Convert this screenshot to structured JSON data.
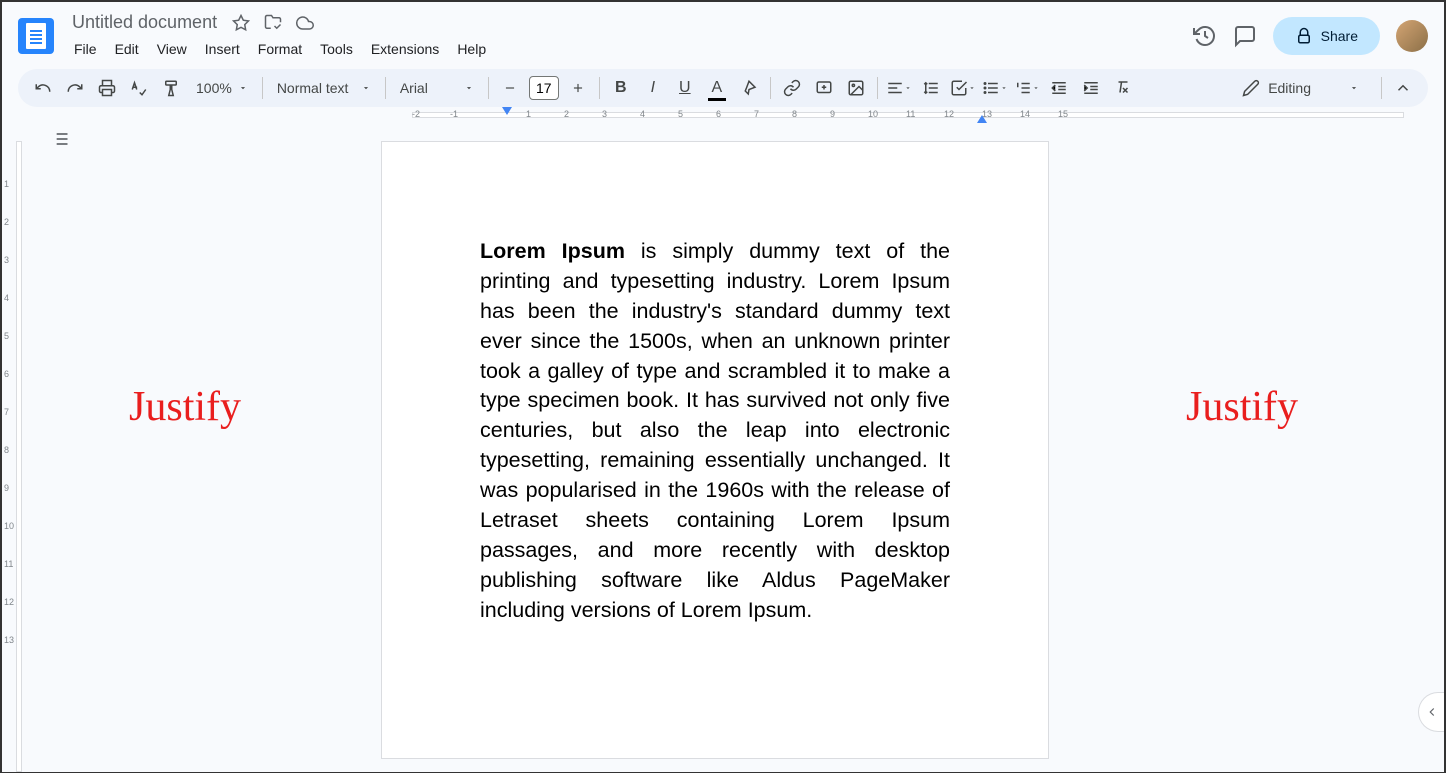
{
  "header": {
    "title": "Untitled document",
    "menu": [
      "File",
      "Edit",
      "View",
      "Insert",
      "Format",
      "Tools",
      "Extensions",
      "Help"
    ],
    "share_label": "Share"
  },
  "toolbar": {
    "zoom": "100%",
    "style": "Normal text",
    "font": "Arial",
    "font_size": "17",
    "editing_label": "Editing"
  },
  "ruler_h": [
    "-2",
    "-1",
    "",
    "1",
    "2",
    "3",
    "4",
    "5",
    "6",
    "7",
    "8",
    "9",
    "10",
    "11",
    "12",
    "13",
    "14",
    "15"
  ],
  "ruler_v": [
    "",
    "1",
    "2",
    "3",
    "4",
    "5",
    "6",
    "7",
    "8",
    "9",
    "10",
    "11",
    "12",
    "13"
  ],
  "document": {
    "bold_lead": "Lorem Ipsum",
    "body": " is simply dummy text of the printing and typesetting industry. Lorem Ipsum has been the industry's standard dummy text ever since the 1500s, when an unknown printer took a galley of type and scrambled it to make a type specimen book. It has survived not only five centuries, but also the leap into electronic typesetting, remaining essentially unchanged. It was popularised in the 1960s with the release of Letraset sheets containing Lorem Ipsum passages, and more recently with desktop publishing software like Aldus PageMaker including versions of Lorem Ipsum."
  },
  "annotations": {
    "left": "Justify",
    "right": "Justify"
  }
}
